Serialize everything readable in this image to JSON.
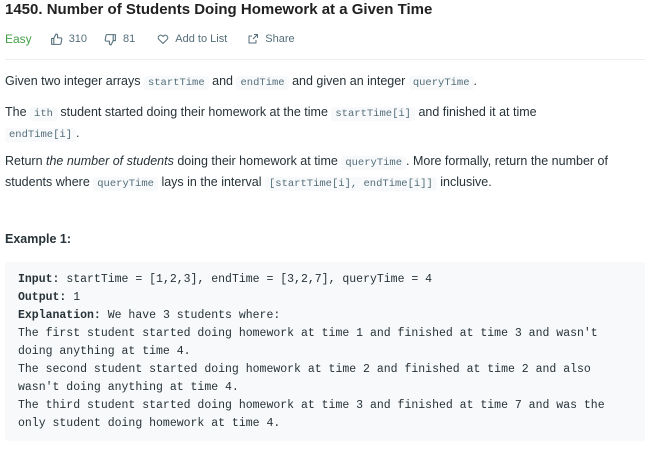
{
  "problem": {
    "title": "1450. Number of Students Doing Homework at a Given Time",
    "difficulty": "Easy",
    "likes": "310",
    "dislikes": "81",
    "add_to_list": "Add to List",
    "share": "Share"
  },
  "description": {
    "p1": {
      "t1": "Given two integer arrays ",
      "c1": "startTime",
      "t2": " and ",
      "c2": "endTime",
      "t3": " and given an integer ",
      "c3": "queryTime",
      "t4": "."
    },
    "p2": {
      "t1": "The ",
      "c1": "ith",
      "t2": " student started doing their homework at the time ",
      "c2": "startTime[i]",
      "t3": " and finished it at time ",
      "c3": "endTime[i]",
      "t4": "."
    },
    "p3": {
      "t1": "Return ",
      "em1": "the number of students",
      "t2": " doing their homework at time ",
      "c1": "queryTime",
      "t3": ". More formally, return the number of students where ",
      "c2": "queryTime",
      "t4": " lays in the interval ",
      "c3": "[startTime[i], endTime[i]]",
      "t5": " inclusive."
    }
  },
  "example": {
    "title": "Example 1:",
    "input_label": "Input:",
    "input_value": " startTime = [1,2,3], endTime = [3,2,7], queryTime = 4",
    "output_label": "Output:",
    "output_value": " 1",
    "explanation_label": "Explanation:",
    "explanation_value": " We have 3 students where:",
    "lines": [
      "The first student started doing homework at time 1 and finished at time 3 and wasn't",
      "doing anything at time 4.",
      "The second student started doing homework at time 2 and finished at time 2 and also",
      "wasn't doing anything at time 4.",
      "The third student started doing homework at time 3 and finished at time 7 and was the",
      "only student doing homework at time 4."
    ]
  },
  "colors": {
    "easy": "#43a047",
    "meta": "#546e7a",
    "code_bg": "#f7f9fa"
  }
}
